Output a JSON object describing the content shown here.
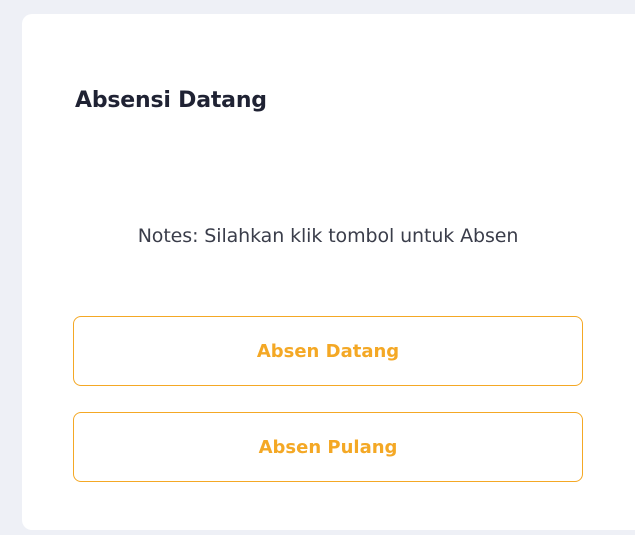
{
  "card": {
    "title": "Absensi Datang",
    "notes": "Notes: Silahkan klik tombol untuk Absen"
  },
  "buttons": {
    "datang_label": "Absen Datang",
    "pulang_label": "Absen Pulang"
  },
  "colors": {
    "accent": "#f4a825",
    "background": "#eef0f6",
    "card": "#ffffff",
    "title_text": "#1f2233",
    "body_text": "#3a3d4a"
  }
}
